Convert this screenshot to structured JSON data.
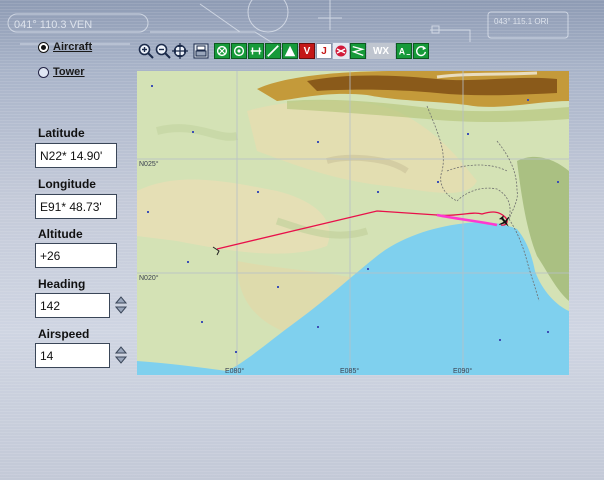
{
  "mode": {
    "aircraft_label": "Aircraft",
    "tower_label": "Tower",
    "selected": "aircraft"
  },
  "fields": {
    "latitude": {
      "label": "Latitude",
      "value": "N22* 14.90'"
    },
    "longitude": {
      "label": "Longitude",
      "value": "E91* 48.73'"
    },
    "altitude": {
      "label": "Altitude",
      "value": "+26"
    },
    "heading": {
      "label": "Heading",
      "value": "142"
    },
    "airspeed": {
      "label": "Airspeed",
      "value": "14"
    }
  },
  "toolbar": {
    "icons": [
      "zoom-in-icon",
      "zoom-out-icon",
      "center-on-aircraft-icon",
      "print-icon",
      "vor-icon",
      "ndb-icon",
      "ils-icon",
      "airway-icon",
      "intersection-icon",
      "v-label-icon",
      "j-label-icon",
      "airport-icon",
      "flight-path-icon",
      "weather-icon",
      "cross-icon",
      "label-icon",
      "refresh-icon"
    ],
    "v_label": "V",
    "j_label": "J",
    "wx_label": "WX"
  },
  "map": {
    "lat_labels": [
      "N025°",
      "N020°"
    ],
    "lon_labels": [
      "E080°",
      "E085°",
      "E090°"
    ],
    "colors": {
      "sea": "#7fd0ee",
      "land": "#d4e2b5",
      "track": "#e8104a",
      "highlight": "#ff38d0"
    }
  },
  "background_text": {
    "top_left": "041° 110.3 VEN",
    "top_right": "043° 115.1 ORI"
  }
}
